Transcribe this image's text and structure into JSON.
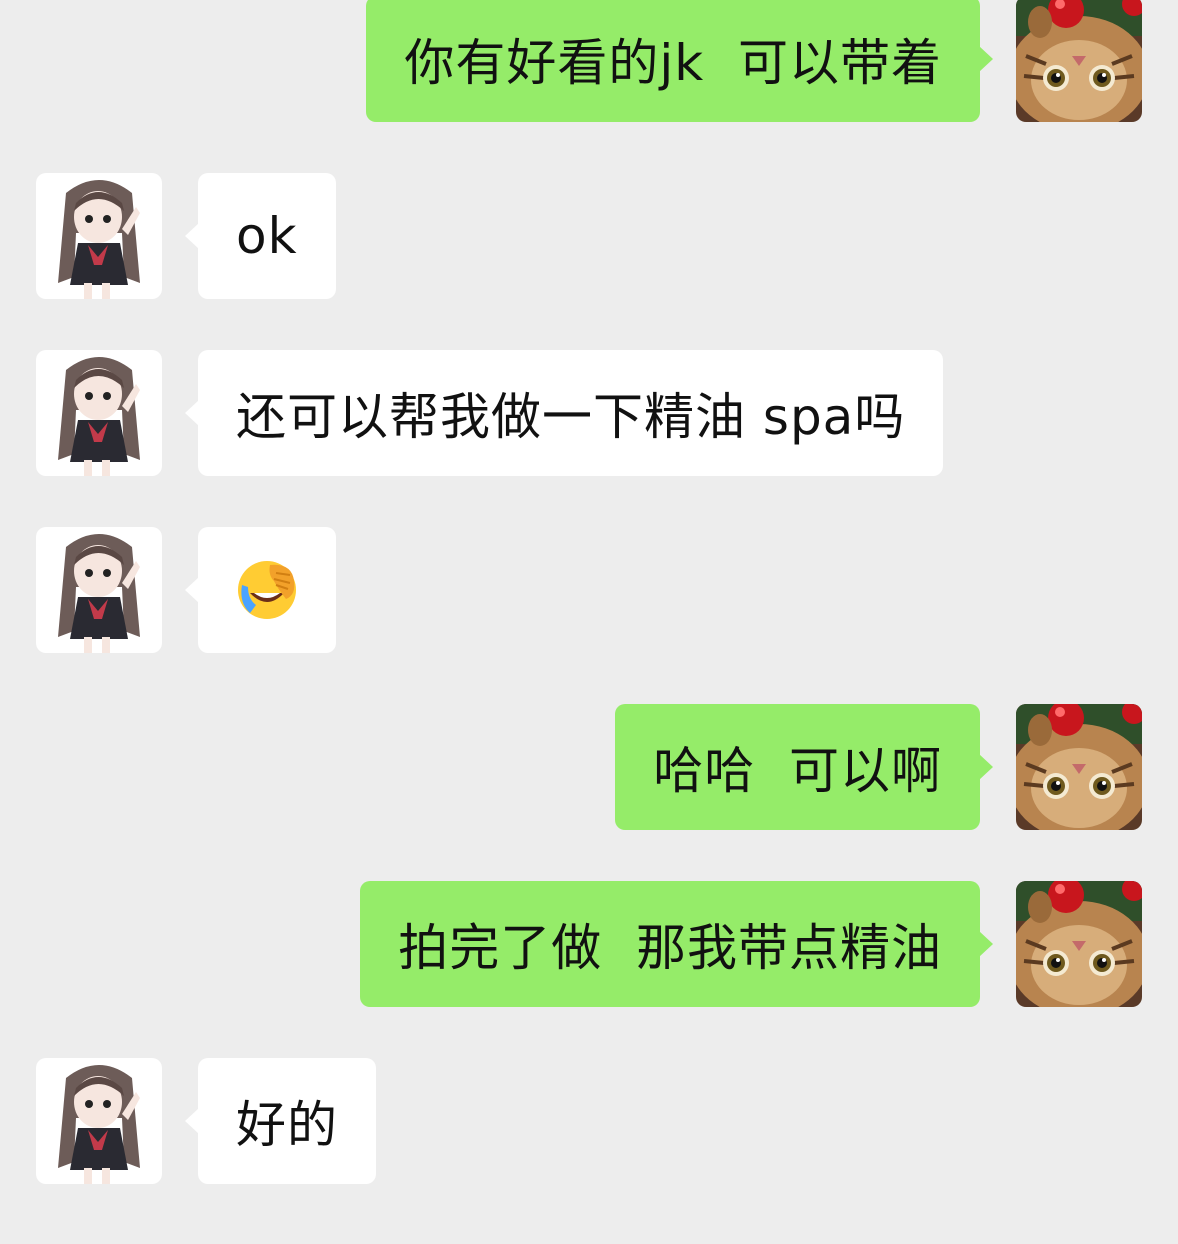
{
  "chat": {
    "messages": [
      {
        "side": "out",
        "text": "你有好看的jk  可以带着",
        "avatar": "cat-avatar"
      },
      {
        "side": "in",
        "text": "ok",
        "avatar": "anime-girl-avatar"
      },
      {
        "side": "in",
        "text": "还可以帮我做一下精油 spa吗",
        "avatar": "anime-girl-avatar"
      },
      {
        "side": "in",
        "emoji": "face-palm-laughing-tears-emoji",
        "avatar": "anime-girl-avatar"
      },
      {
        "side": "out",
        "text": "哈哈  可以啊",
        "avatar": "cat-avatar"
      },
      {
        "side": "out",
        "text": "拍完了做  那我带点精油",
        "avatar": "cat-avatar"
      },
      {
        "side": "in",
        "text": "好的",
        "avatar": "anime-girl-avatar"
      }
    ]
  },
  "colors": {
    "background": "#ededed",
    "outgoing_bubble": "#95ec69",
    "incoming_bubble": "#ffffff",
    "text": "#111111"
  }
}
